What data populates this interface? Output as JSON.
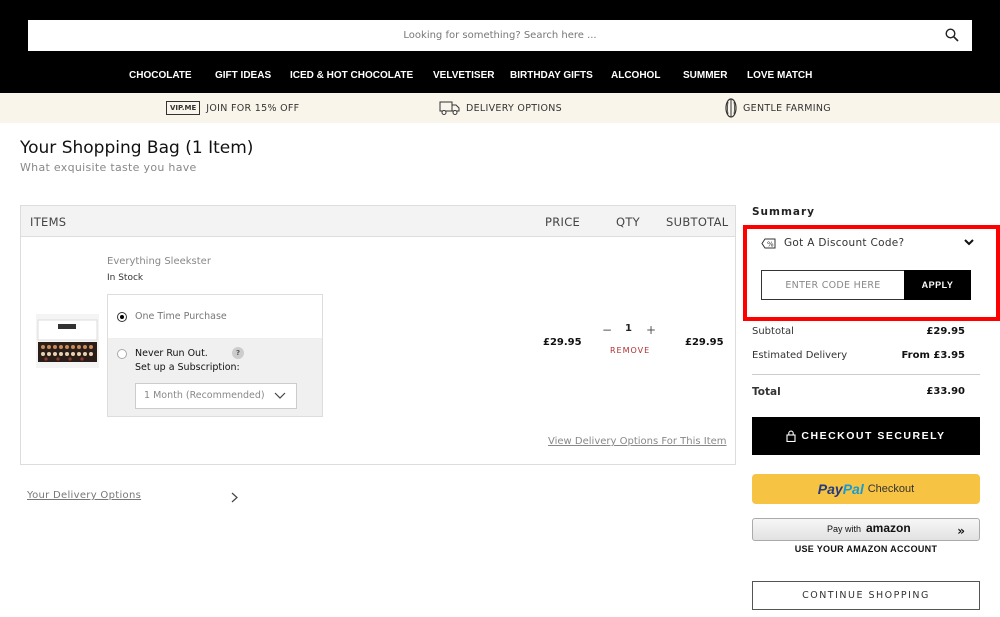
{
  "search": {
    "placeholder": "Looking for something? Search here ..."
  },
  "nav": {
    "items": [
      "CHOCOLATE",
      "GIFT IDEAS",
      "ICED & HOT CHOCOLATE",
      "VELVETISER",
      "BIRTHDAY GIFTS",
      "ALCOHOL",
      "SUMMER",
      "LOVE MATCH"
    ]
  },
  "perks": {
    "vip_badge": "VIP.ME",
    "join": "JOIN FOR 15% OFF",
    "delivery": "DELIVERY OPTIONS",
    "farming": "GENTLE FARMING"
  },
  "bag": {
    "title": "Your Shopping Bag (1 Item)",
    "subtitle": "What exquisite taste you have",
    "headers": {
      "items": "ITEMS",
      "price": "PRICE",
      "qty": "QTY",
      "subtotal": "SUBTOTAL"
    },
    "item": {
      "name": "Everything Sleekster",
      "stock": "In Stock",
      "option_one_time": "One Time Purchase",
      "option_never_run_out": "Never Run Out.",
      "option_subscription": "Set up a Subscription:",
      "help_mark": "?",
      "subscription_select": "1 Month (Recommended)",
      "price": "£29.95",
      "qty": "1",
      "qty_minus": "−",
      "qty_plus": "+",
      "remove": "REMOVE",
      "subtotal": "£29.95",
      "view_delivery": "View Delivery Options For This Item"
    },
    "your_delivery_options": "Your Delivery Options"
  },
  "summary": {
    "title": "Summary",
    "discount_label": "Got A Discount Code?",
    "code_placeholder": "ENTER CODE HERE",
    "apply": "APPLY",
    "subtotal_label": "Subtotal",
    "subtotal_value": "£29.95",
    "delivery_label": "Estimated Delivery",
    "delivery_value": "From £3.95",
    "total_label": "Total",
    "total_value": "£33.90",
    "checkout": "CHECKOUT SECURELY",
    "paypal_a": "Pay",
    "paypal_b": "Pal",
    "paypal_checkout": "Checkout",
    "amazon_pay_with": "Pay with",
    "amazon_logo": "amazon",
    "amazon_caption": "USE YOUR AMAZON ACCOUNT",
    "continue": "CONTINUE SHOPPING"
  },
  "colors": {
    "header_bg": "#000000",
    "perks_bg": "#faf5ea",
    "highlight": "#ff0000",
    "paypal_yellow": "#f6c342",
    "remove_red": "#b03030"
  }
}
